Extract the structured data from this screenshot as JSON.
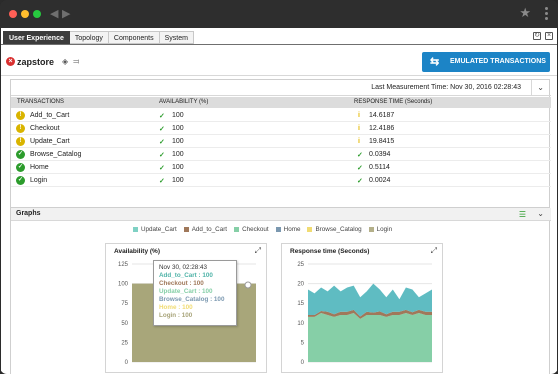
{
  "window": {
    "back_icon": "chevron-left-icon",
    "forward_icon": "chevron-right-icon",
    "star_icon": "star-icon",
    "menu_icon": "kebab-menu-icon"
  },
  "tabs": [
    {
      "label": "User Experience",
      "active": true
    },
    {
      "label": "Topology",
      "active": false
    },
    {
      "label": "Components",
      "active": false
    },
    {
      "label": "System",
      "active": false
    }
  ],
  "component": {
    "name": "zapstore",
    "status": "critical"
  },
  "emulated_button": {
    "label": "EMULATED TRANSACTIONS"
  },
  "measurement": {
    "label": "Last Measurement Time: Nov 30, 2016 02:28:43"
  },
  "table": {
    "headers": [
      "TRANSACTIONS",
      "AVAILABILITY (%)",
      "RESPONSE TIME (Seconds)"
    ],
    "rows": [
      {
        "name": "Add_to_Cart",
        "status": "warning",
        "availability": "100",
        "response": "14.6187",
        "response_status": "warning"
      },
      {
        "name": "Checkout",
        "status": "warning",
        "availability": "100",
        "response": "12.4186",
        "response_status": "warning"
      },
      {
        "name": "Update_Cart",
        "status": "warning",
        "availability": "100",
        "response": "19.8415",
        "response_status": "warning"
      },
      {
        "name": "Browse_Catalog",
        "status": "ok",
        "availability": "100",
        "response": "0.0394",
        "response_status": "ok"
      },
      {
        "name": "Home",
        "status": "ok",
        "availability": "100",
        "response": "0.5114",
        "response_status": "ok"
      },
      {
        "name": "Login",
        "status": "ok",
        "availability": "100",
        "response": "0.0024",
        "response_status": "ok"
      }
    ]
  },
  "graphs": {
    "title": "Graphs",
    "legend": [
      {
        "name": "Update_Cart",
        "color": "#7fd1c4"
      },
      {
        "name": "Add_to_Cart",
        "color": "#a0785a"
      },
      {
        "name": "Checkout",
        "color": "#86cfa7"
      },
      {
        "name": "Home",
        "color": "#7b98b0"
      },
      {
        "name": "Browse_Catalog",
        "color": "#f1dc73"
      },
      {
        "name": "Login",
        "color": "#b4b08a"
      }
    ],
    "tooltip": {
      "time": "Nov 30, 02:28:43",
      "lines": [
        {
          "text": "Add_to_Cart : 100",
          "color": "#4fb3a8"
        },
        {
          "text": "Checkout : 100",
          "color": "#a0785a"
        },
        {
          "text": "Update_Cart : 100",
          "color": "#86cfa7"
        },
        {
          "text": "Browse_Catalog : 100",
          "color": "#7b98b0"
        },
        {
          "text": "Home : 100",
          "color": "#f1dc73"
        },
        {
          "text": "Login : 100",
          "color": "#a8a47a"
        }
      ]
    }
  },
  "chart_data": [
    {
      "type": "area",
      "title": "Availability (%)",
      "ylim": [
        0,
        125
      ],
      "yticks": [
        "125",
        "100",
        "75",
        "50",
        "25",
        "0"
      ],
      "series": [
        {
          "name": "Login",
          "values": [
            100,
            100,
            100,
            100,
            100,
            100,
            100,
            100,
            100,
            100,
            100,
            100,
            100
          ]
        }
      ]
    },
    {
      "type": "area",
      "title": "Response time (Seconds)",
      "ylim": [
        0,
        25
      ],
      "yticks": [
        "25",
        "20",
        "15",
        "10",
        "5",
        "0"
      ],
      "series": [
        {
          "name": "Checkout",
          "values": [
            11.5,
            11.5,
            12.5,
            12.0,
            11.5,
            12.0,
            12.0,
            12.5,
            11.0,
            12.0,
            12.0,
            12.0,
            11.5,
            12.0,
            12.0,
            12.5,
            12.0,
            12.5,
            12.0,
            12.0
          ]
        },
        {
          "name": "Add_to_Cart",
          "values": [
            12.0,
            12.0,
            13.0,
            12.8,
            12.2,
            12.8,
            12.8,
            13.3,
            11.6,
            12.8,
            12.6,
            12.9,
            12.2,
            12.8,
            12.8,
            13.3,
            12.7,
            13.3,
            12.8,
            12.8
          ]
        },
        {
          "name": "Update_Cart",
          "values": [
            18.5,
            17.5,
            19.0,
            18.0,
            19.5,
            18.0,
            19.0,
            19.5,
            16.5,
            18.0,
            20.0,
            18.5,
            16.5,
            18.5,
            16.0,
            19.0,
            18.5,
            16.5,
            17.5,
            18.5
          ]
        }
      ]
    }
  ]
}
